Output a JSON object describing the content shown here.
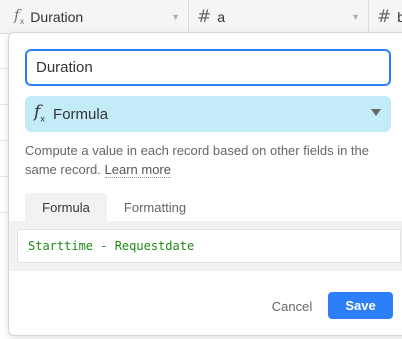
{
  "grid": {
    "columns": [
      {
        "icon": "formula-icon",
        "label": "Duration"
      },
      {
        "icon": "number-icon",
        "label": "a"
      },
      {
        "icon": "number-icon",
        "label": "b"
      }
    ]
  },
  "popup": {
    "field_name": "Duration",
    "type_icon": "formula-icon",
    "type_label": "Formula",
    "description": "Compute a value in each record based on other fields in the same record.",
    "learn_more": "Learn more",
    "tabs": [
      "Formula",
      "Formatting"
    ],
    "active_tab": "Formula",
    "formula": "Starttime - Requestdate",
    "cancel_label": "Cancel",
    "save_label": "Save"
  },
  "colors": {
    "accent": "#2d7ff9",
    "type_bg": "#c4ecf8",
    "formula_text": "#1e8a14"
  }
}
